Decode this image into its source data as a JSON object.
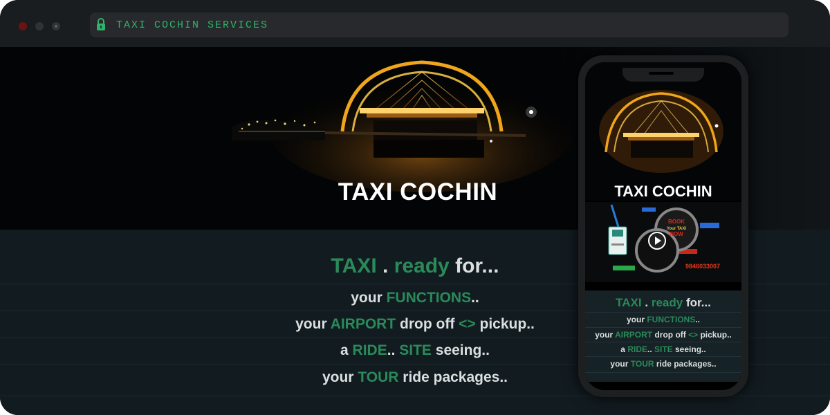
{
  "browser": {
    "url": "TAXI COCHIN SERVICES"
  },
  "hero": {
    "title": "TAXI COCHIN"
  },
  "tagline": {
    "taxi": "TAXI",
    "dot": ".",
    "ready": "ready",
    "for": "for..."
  },
  "services": {
    "line1": {
      "pre": "your ",
      "hl": "FUNCTIONS",
      "post": ".."
    },
    "line2": {
      "pre": "your ",
      "hl": "AIRPORT",
      "mid": " drop off ",
      "hl2": "<>",
      "post": " pickup.."
    },
    "line3": {
      "pre": "a ",
      "hl": "RIDE",
      "mid": "..  ",
      "hl2": "SITE",
      "post": " seeing.."
    },
    "line4": {
      "pre": "your ",
      "hl": "TOUR",
      "post": " ride packages.."
    }
  },
  "phone": {
    "title": "TAXI COCHIN",
    "video": {
      "book_top": "BOOK",
      "book_mid": "Your TAXI",
      "book_bottom": "NOW",
      "phone_number": "9846033007"
    }
  },
  "colors": {
    "accent_green": "#2a8a5a",
    "url_green": "#2fb36a",
    "arch_gold": "#e8a020"
  }
}
